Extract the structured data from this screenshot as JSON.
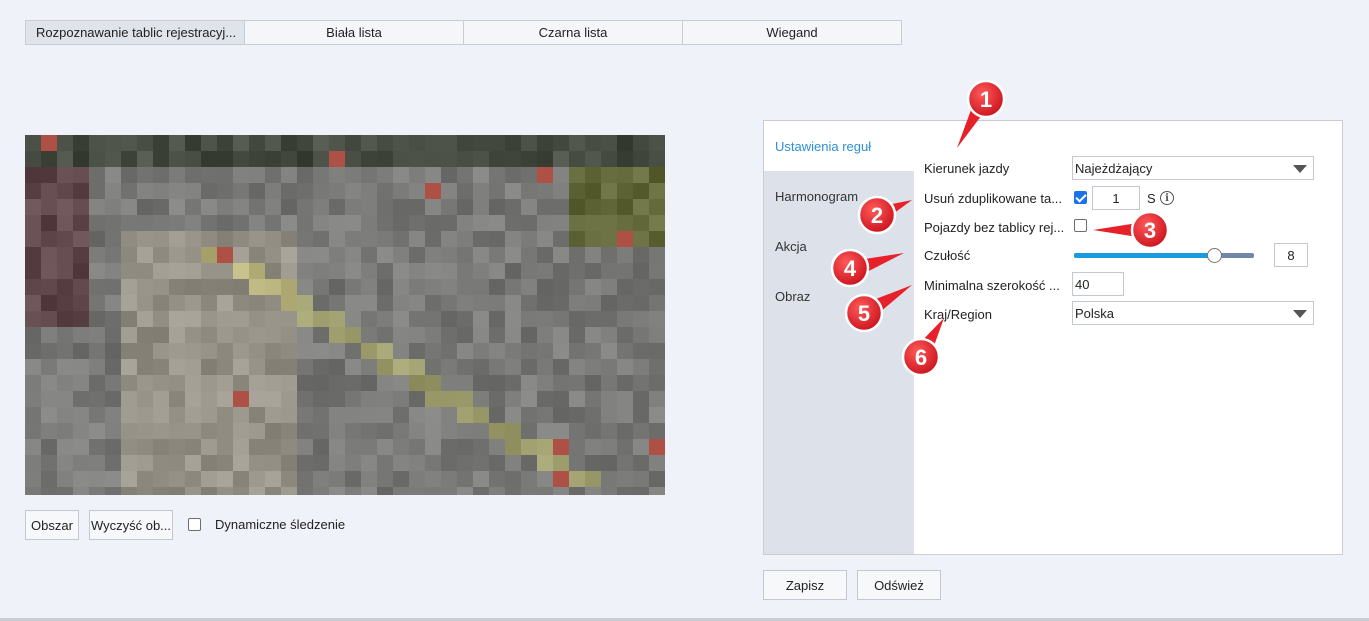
{
  "tabs": [
    {
      "label": "Rozpoznawanie tablic rejestracyj...",
      "active": true
    },
    {
      "label": "Biała lista",
      "active": false
    },
    {
      "label": "Czarna lista",
      "active": false
    },
    {
      "label": "Wiegand",
      "active": false
    }
  ],
  "video_controls": {
    "area_button": "Obszar",
    "clear_button": "Wyczyść ob...",
    "dynamic_tracking_label": "Dynamiczne śledzenie",
    "dynamic_tracking_checked": false
  },
  "sidenav": {
    "items": [
      {
        "label": "Ustawienia reguł",
        "active": true
      },
      {
        "label": "Harmonogram",
        "active": false
      },
      {
        "label": "Akcja",
        "active": false
      },
      {
        "label": "Obraz",
        "active": false
      }
    ]
  },
  "rules": {
    "direction": {
      "label": "Kierunek jazdy",
      "value": "Najeżdżający"
    },
    "dedupe": {
      "label": "Usuń zduplikowane ta...",
      "checked": true,
      "value": "1",
      "unit": "S"
    },
    "no_plate": {
      "label": "Pojazdy bez tablicy rej...",
      "checked": false
    },
    "sensitivity": {
      "label": "Czułość",
      "value": "8",
      "level_fraction": 0.78
    },
    "min_width": {
      "label": "Minimalna szerokość ...",
      "value": "40"
    },
    "region": {
      "label": "Kraj/Region",
      "value": "Polska"
    }
  },
  "actions": {
    "save": "Zapisz",
    "refresh": "Odśwież"
  },
  "callouts": [
    "1",
    "2",
    "3",
    "4",
    "5",
    "6"
  ],
  "colors": {
    "accent": "#1a9ae0",
    "callout_red": "#e8202a",
    "active_nav_text": "#2d8fd5"
  }
}
